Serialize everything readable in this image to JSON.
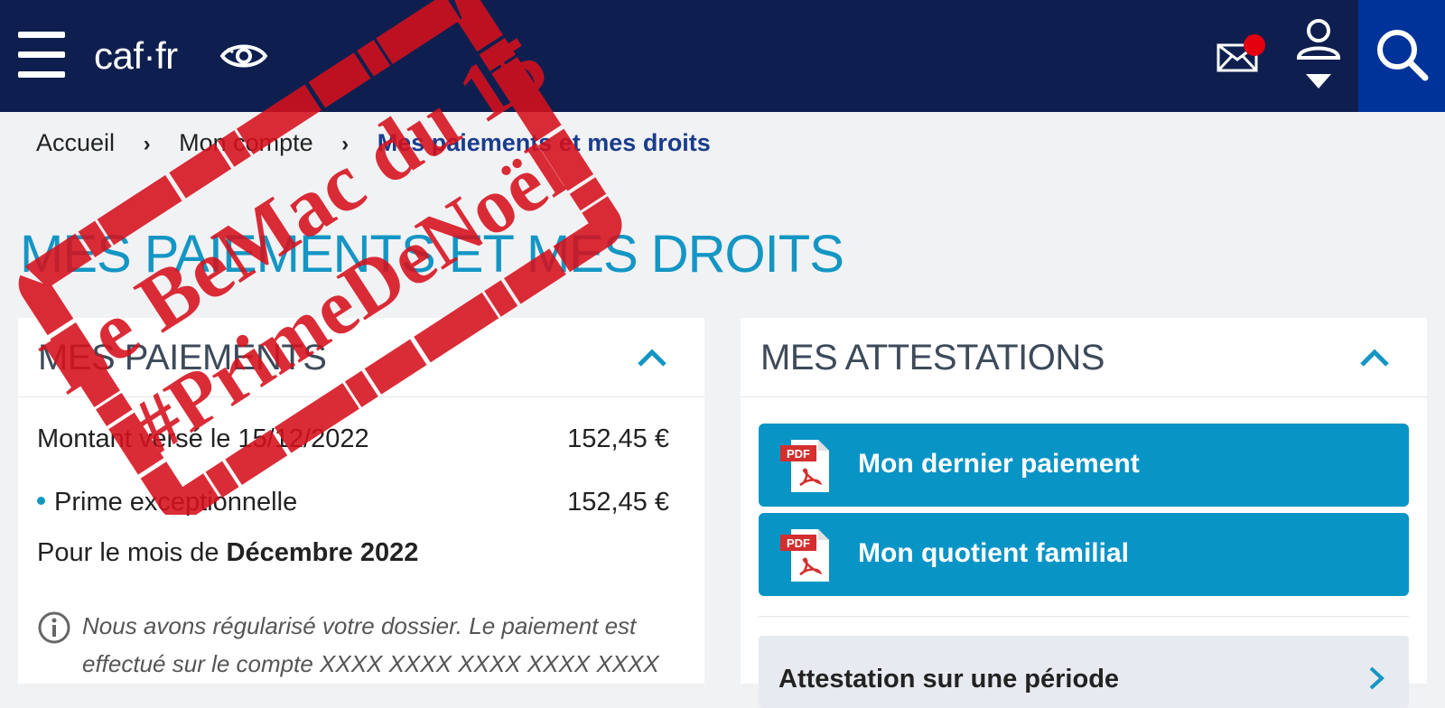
{
  "header": {
    "logo": "caf·fr",
    "icons": [
      "menu-icon",
      "eye-icon",
      "mail-icon",
      "user-icon",
      "search-icon"
    ],
    "accent_colors": {
      "header_bg": "#0e1f4f",
      "search_bg": "#003399",
      "notification": "#e3000f"
    }
  },
  "breadcrumb": {
    "items": [
      "Accueil",
      "Mon compte",
      "Mes paiements et mes droits"
    ]
  },
  "page_title": "MES PAIEMENTS ET MES DROITS",
  "payments": {
    "title": "MES PAIEMENTS",
    "amount_label": "Montant versé le 15/12/2022",
    "amount_value": "152,45 €",
    "item_label": "Prime exceptionnelle",
    "item_value": "152,45 €",
    "month_prefix": "Pour le mois de ",
    "month_value": "Décembre 2022",
    "info_line1": "Nous avons régularisé votre dossier. Le paiement est",
    "info_line2": "effectué sur le compte XXXX XXXX XXXX XXXX XXXX"
  },
  "attestations": {
    "title": "MES ATTESTATIONS",
    "buttons": [
      {
        "label": "Mon dernier paiement",
        "icon": "pdf-icon"
      },
      {
        "label": "Mon quotient familial",
        "icon": "pdf-icon"
      }
    ],
    "period_label": "Attestation sur une période"
  },
  "stamp": {
    "line1": "Le BeMac du 15",
    "line2": "#PrimeDeNoël",
    "color": "#d6101c"
  }
}
